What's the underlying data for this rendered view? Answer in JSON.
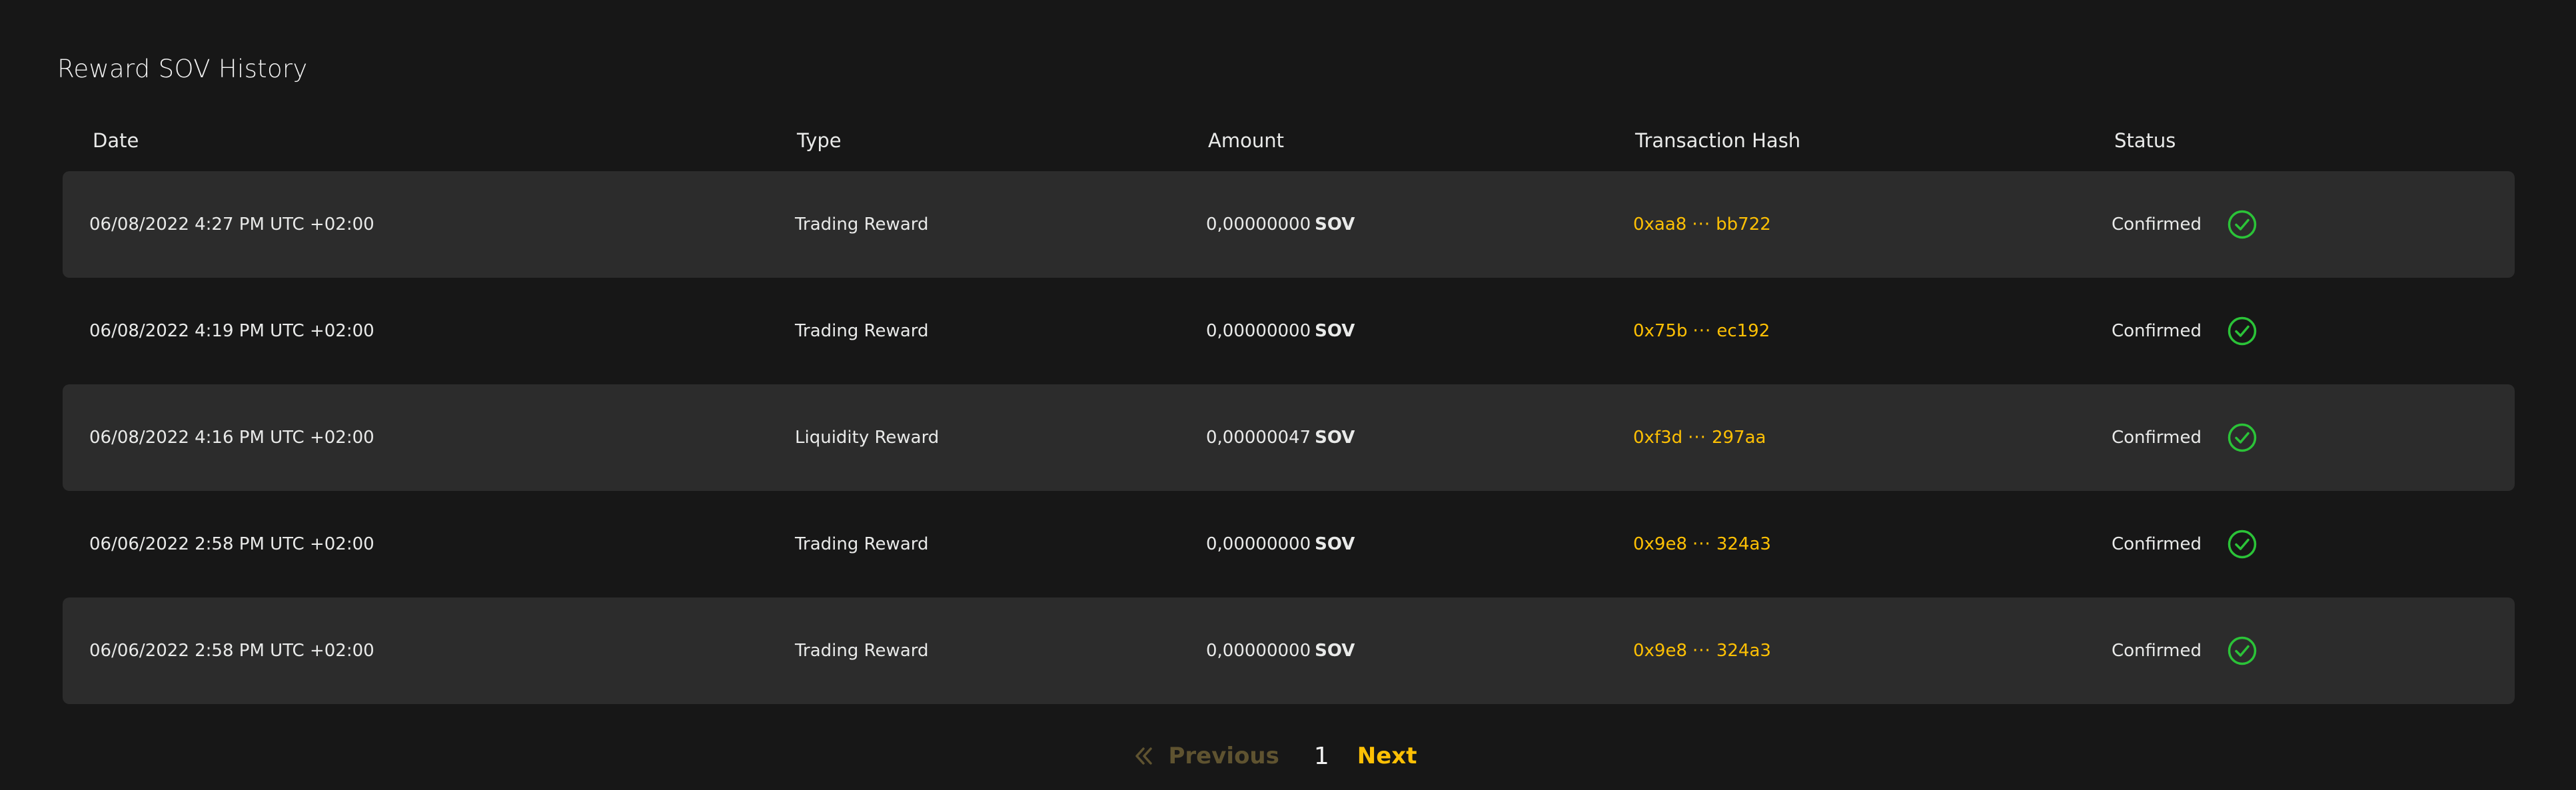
{
  "page": {
    "title": "Reward SOV History"
  },
  "table": {
    "headers": {
      "date": "Date",
      "type": "Type",
      "amount": "Amount",
      "hash": "Transaction Hash",
      "status": "Status"
    },
    "rows": [
      {
        "date": "06/08/2022 4:27 PM UTC +02:00",
        "type": "Trading Reward",
        "amount": "0,00000000",
        "unit": "SOV",
        "hash_start": "0xaa8",
        "hash_sep": "···",
        "hash_end": "bb722",
        "status": "Confirmed",
        "status_icon": "check-circle-icon"
      },
      {
        "date": "06/08/2022 4:19 PM UTC +02:00",
        "type": "Trading Reward",
        "amount": "0,00000000",
        "unit": "SOV",
        "hash_start": "0x75b",
        "hash_sep": "···",
        "hash_end": "ec192",
        "status": "Confirmed",
        "status_icon": "check-circle-icon"
      },
      {
        "date": "06/08/2022 4:16 PM UTC +02:00",
        "type": "Liquidity Reward",
        "amount": "0,00000047",
        "unit": "SOV",
        "hash_start": "0xf3d",
        "hash_sep": "···",
        "hash_end": "297aa",
        "status": "Confirmed",
        "status_icon": "check-circle-icon"
      },
      {
        "date": "06/06/2022 2:58 PM UTC +02:00",
        "type": "Trading Reward",
        "amount": "0,00000000",
        "unit": "SOV",
        "hash_start": "0x9e8",
        "hash_sep": "···",
        "hash_end": "324a3",
        "status": "Confirmed",
        "status_icon": "check-circle-icon"
      },
      {
        "date": "06/06/2022 2:58 PM UTC +02:00",
        "type": "Trading Reward",
        "amount": "0,00000000",
        "unit": "SOV",
        "hash_start": "0x9e8",
        "hash_sep": "···",
        "hash_end": "324a3",
        "status": "Confirmed",
        "status_icon": "check-circle-icon"
      }
    ]
  },
  "pagination": {
    "previous_label": "Previous",
    "current_page": "1",
    "next_label": "Next",
    "previous_icon": "double-chevron-left-icon"
  },
  "colors": {
    "background": "#171717",
    "row_shaded": "#2c2c2c",
    "accent": "#fec004",
    "confirmed_green": "#2bc338",
    "disabled": "#5f5330"
  }
}
